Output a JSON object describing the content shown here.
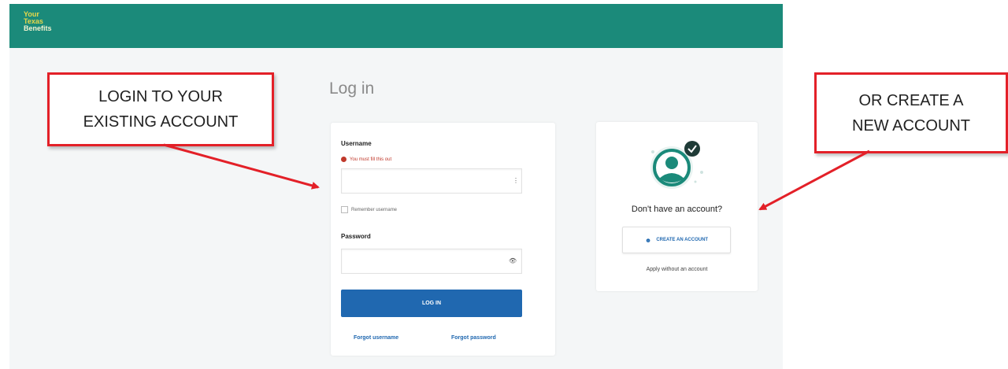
{
  "header": {
    "logo_lines": [
      "Your",
      "Texas",
      "Benefits"
    ],
    "color": "#1b8a7a"
  },
  "login": {
    "title": "Log in",
    "username_label": "Username",
    "username_error": "You must fill this out",
    "username_value": "",
    "remember_label": "Remember username",
    "remember_checked": false,
    "password_label": "Password",
    "password_value": "",
    "login_button": "Log in",
    "forgot_username": "Forgot username",
    "forgot_password": "Forgot password",
    "button_color": "#2068b0"
  },
  "create": {
    "prompt": "Don't have an account?",
    "button": "CREATE AN ACCOUNT",
    "apply_link": "Apply without an account",
    "icon": "user-avatar-check-icon"
  },
  "annotations": {
    "left_line1": "LOGIN TO YOUR",
    "left_line2": "EXISTING ACCOUNT",
    "right_line1": "OR CREATE A",
    "right_line2": "NEW ACCOUNT",
    "color": "#e32028"
  }
}
